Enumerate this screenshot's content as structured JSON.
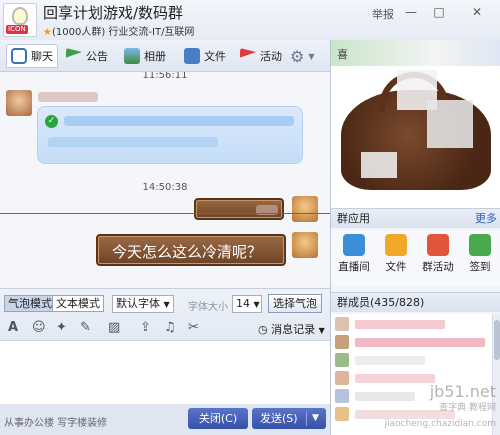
{
  "header": {
    "group_name": "回享计划游戏/数码群",
    "group_info": "(1000人群) 行业交流-IT/互联网",
    "report_label": "举报",
    "minimize_glyph": "—",
    "maximize_glyph": "□",
    "close_glyph": "✕",
    "avatar_tag": "ICON"
  },
  "toolbar": {
    "items": [
      {
        "label": "聊天",
        "icon": "chat-bubble-icon",
        "active": true
      },
      {
        "label": "公告",
        "icon": "flag-green-icon"
      },
      {
        "label": "相册",
        "icon": "picture-icon"
      },
      {
        "label": "文件",
        "icon": "folder-icon"
      },
      {
        "label": "活动",
        "icon": "flag-red-icon"
      }
    ],
    "settings_icon": "gear-icon"
  },
  "chat": {
    "timestamp_top": "11:56:11",
    "timestamp_mid": "14:50:38",
    "verified_glyph": "✓",
    "sent_message": "今天怎么这么冷清呢？"
  },
  "input_bar": {
    "mode_bubble": "气泡模式",
    "mode_text": "文本模式",
    "font_select": "默认字体",
    "size_label": "字体大小",
    "size_value": "14",
    "choose_bubble": "选择气泡",
    "history": "消息记录",
    "icon_glyphs": {
      "font": "A",
      "emoji": "☺",
      "magic": "✦",
      "vibrate": "✎",
      "screenshot": "▨",
      "upload": "⇪",
      "music": "♫",
      "scissors": "✂",
      "history_clock": "◷"
    }
  },
  "footer": {
    "ad_text": "从事办公楼 写字楼装修",
    "close_button": "关闭(C)",
    "send_button": "发送(S)",
    "send_dropdown": "▼"
  },
  "right_panel": {
    "ad_top_text": "喜",
    "apps_title": "群应用",
    "apps_more": "更多",
    "apps": [
      {
        "label": "直播间",
        "icon": "live-room-icon",
        "color": "#3b8fd9"
      },
      {
        "label": "文件",
        "icon": "folder-app-icon",
        "color": "#f0a72a"
      },
      {
        "label": "群活动",
        "icon": "group-activity-icon",
        "color": "#e2553d"
      },
      {
        "label": "签到",
        "icon": "checkin-icon",
        "color": "#4aa84f"
      }
    ],
    "members_title": "群成员(435/828)"
  },
  "watermark": {
    "line1": "jb51.net",
    "line2": "查字典 教程网",
    "line3": "jiaocheng.chazidian.com"
  },
  "colors": {
    "accent_blue": "#3550a8",
    "annotation_red": "#e0343a",
    "wood_bubble": "#7a4a2e"
  }
}
